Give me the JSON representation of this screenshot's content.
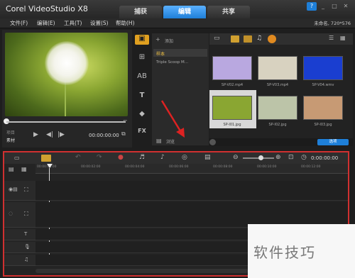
{
  "window": {
    "title": "Corel VideoStudio X8",
    "tabs": [
      "捕获",
      "编辑",
      "共享"
    ],
    "active_tab": "编辑",
    "controls": [
      "?",
      "_",
      "□",
      "✕"
    ]
  },
  "menu": {
    "items": [
      "文件(F)",
      "编辑(E)",
      "工具(T)",
      "设置(S)",
      "帮助(H)"
    ],
    "project": "未命名, 720*576"
  },
  "preview": {
    "mode_project": "项目",
    "mode_clip": "素材",
    "timecode": "00:00:00:00"
  },
  "library": {
    "add_label": "添加",
    "folder_item": "样本",
    "folder_item2": "Triple Scoop M...",
    "browse_label": "浏览",
    "options_label": "选项",
    "thumbs": [
      {
        "name": "SP-V02.mp4",
        "color": "#b9a8e0"
      },
      {
        "name": "SP-V03.mp4",
        "color": "#d8d2c0"
      },
      {
        "name": "SP-V04.wmv",
        "color": "#1a3ed0"
      },
      {
        "name": "SP-I01.jpg",
        "color": "#8aa632"
      },
      {
        "name": "SP-I02.jpg",
        "color": "#bcc4a8"
      },
      {
        "name": "SP-I03.jpg",
        "color": "#c79a74"
      }
    ]
  },
  "timeline": {
    "timecode": "0:00:00:00",
    "ticks": [
      "00:00:00:00",
      "00:00:02:00",
      "00:00:04:00",
      "00:00:06:00",
      "00:00:08:00",
      "00:00:10:00",
      "00:00:12:00"
    ]
  },
  "watermark": {
    "text": "软件技巧"
  }
}
